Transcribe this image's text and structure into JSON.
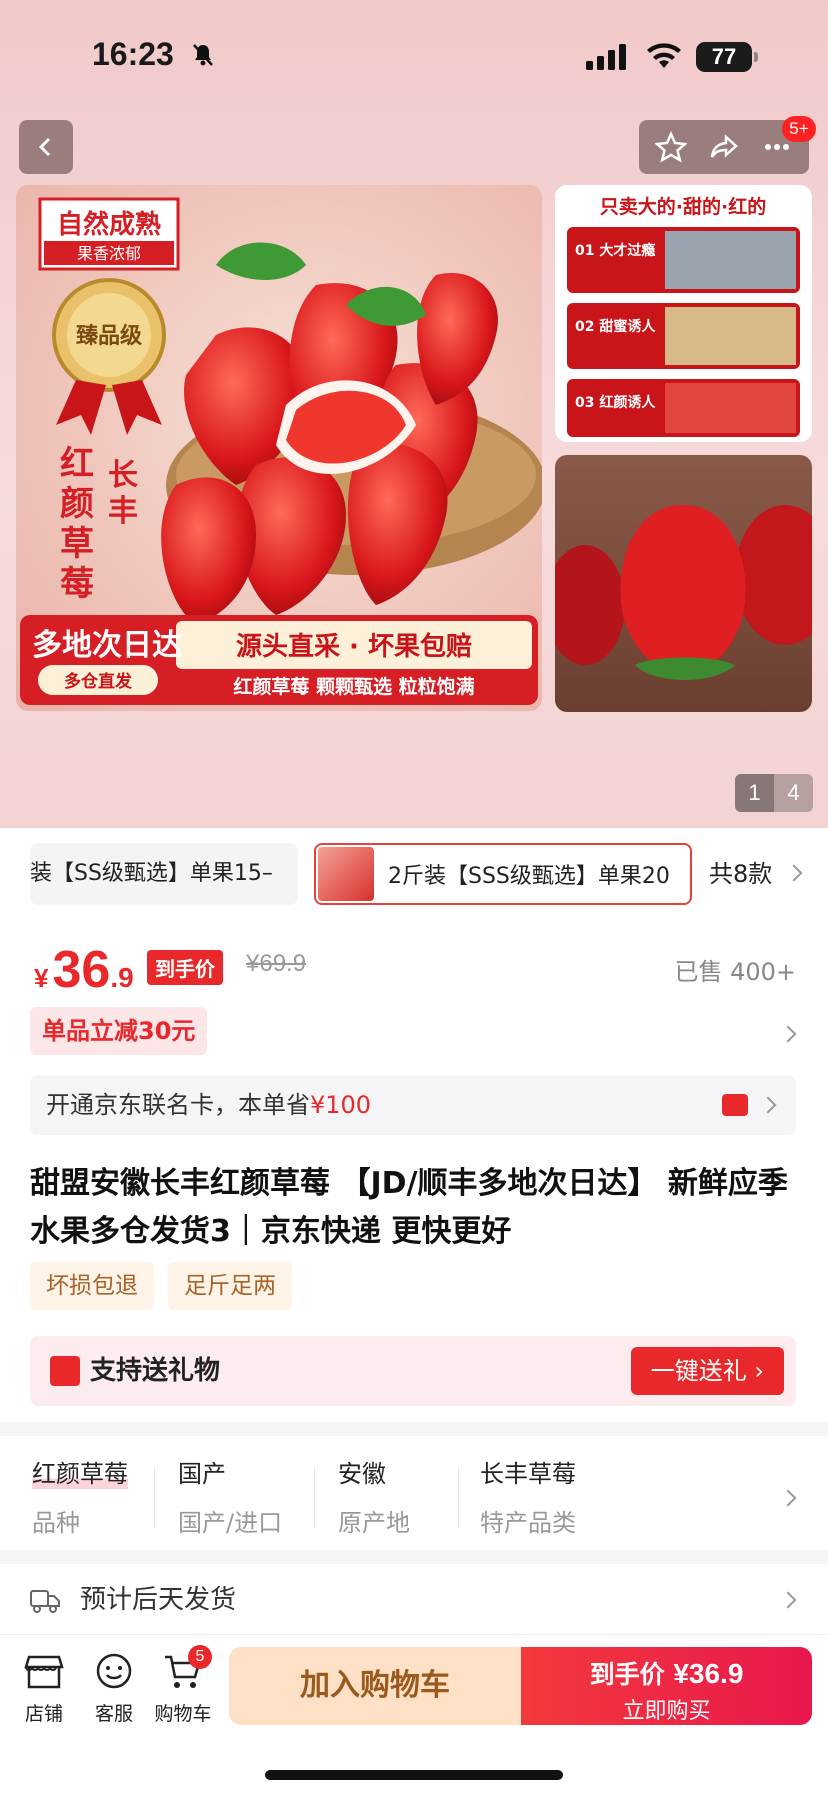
{
  "status": {
    "time": "16:23",
    "battery": "77"
  },
  "topbar": {
    "notify_badge": "5+"
  },
  "pager": {
    "current": "1",
    "total": "4"
  },
  "variants": {
    "items": [
      "装【SS级甄选】单果15–",
      "2斤装【SSS级甄选】单果20"
    ],
    "count": "共8款"
  },
  "price": {
    "symbol": "¥",
    "integer": "36",
    "decimal": ".9",
    "tag": "到手价",
    "original": "¥69.9",
    "sold": "已售 400+"
  },
  "promo": {
    "text": "单品立减30元"
  },
  "card_offer": {
    "text": "开通京东联名卡，本单省",
    "amount": "¥100"
  },
  "title": "甜盟安徽长丰红颜草莓 【JD/顺丰多地次日达】 新鲜应季水果多仓发货3｜京东快递 更快更好",
  "tags": [
    "坏损包退",
    "足斤足两"
  ],
  "gift": {
    "text": "支持送礼物",
    "button": "一键送礼"
  },
  "attributes": [
    {
      "value": "红颜草莓",
      "key": "品种"
    },
    {
      "value": "国产",
      "key": "国产/进口"
    },
    {
      "value": "安徽",
      "key": "原产地"
    },
    {
      "value": "长丰草莓",
      "key": "特产品类"
    }
  ],
  "shipping": {
    "text": "预计后天发货"
  },
  "bottom": {
    "shop": "店铺",
    "service": "客服",
    "cart": "购物车",
    "cart_badge": "5",
    "add_cart": "加入购物车",
    "buy_label": "到手价",
    "buy_price": "¥36.9",
    "buy_now": "立即购买"
  },
  "banner": {
    "top_title": "自然成熟",
    "top_sub": "果香浓郁",
    "seal": "臻品级",
    "vertical1": "红颜草莓",
    "vertical2": "长丰",
    "bottom_left": "多地次日达",
    "bottom_left_sub": "多仓直发",
    "bottom_right": "源头直采 · 坏果包赔",
    "bottom_right_sub": "红颜草莓 颗颗甄选 粒粒饱满",
    "side_title": "只卖大的·甜的·红的",
    "side_items": [
      "01 大才过瘾",
      "02 甜蜜诱人",
      "03 红颜诱人"
    ]
  },
  "colors": {
    "accent": "#e8282b",
    "gold_text": "#a8622a"
  }
}
